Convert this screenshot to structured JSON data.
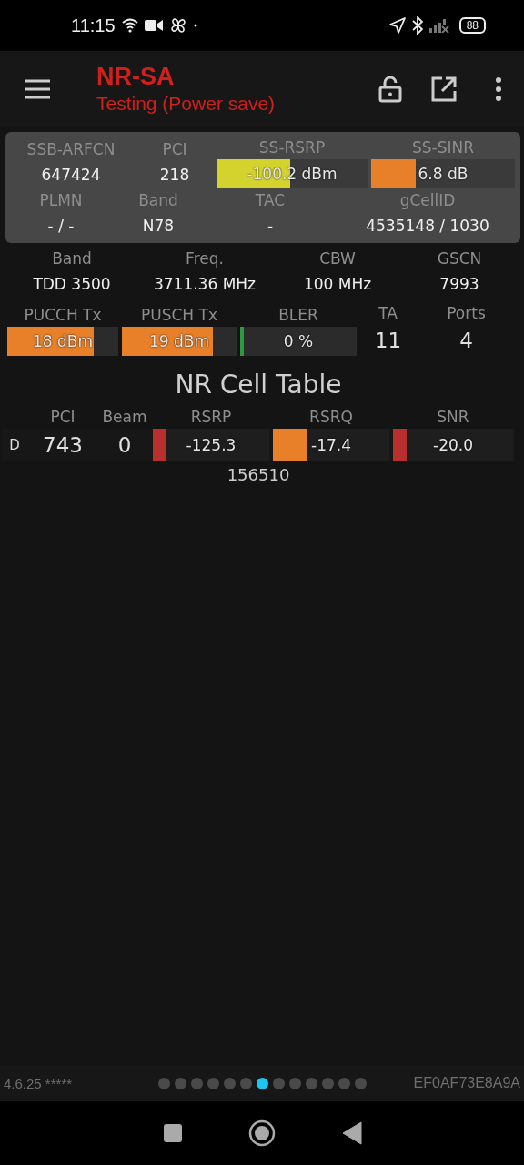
{
  "status_bar": {
    "time": "11:15",
    "battery": "88"
  },
  "app_bar": {
    "title": "NR-SA",
    "subtitle": "Testing (Power save)"
  },
  "serving_panel": {
    "rows": [
      [
        {
          "label": "SSB-ARFCN",
          "kind": "text",
          "value": "647424"
        },
        {
          "label": "PCI",
          "kind": "text",
          "value": "218"
        },
        {
          "label": "SS-RSRP",
          "kind": "meter",
          "value": "-100.2 dBm",
          "level": 0.49,
          "color": "#d4d22c"
        },
        {
          "label": "SS-SINR",
          "kind": "meter",
          "value": "6.8 dB",
          "level": 0.31,
          "color": "#e8802a"
        }
      ],
      [
        {
          "label": "PLMN",
          "kind": "text",
          "value": "- / -"
        },
        {
          "label": "Band",
          "kind": "text",
          "value": "N78"
        },
        {
          "label": "TAC",
          "kind": "text",
          "value": "-"
        },
        {
          "label": "gCellID",
          "kind": "text",
          "value": "4535148 / 1030"
        }
      ]
    ]
  },
  "carrier_info": {
    "rows": [
      [
        {
          "label": "Band",
          "kind": "text",
          "value": "TDD 3500"
        },
        {
          "label": "Freq.",
          "kind": "text",
          "value": "3711.36 MHz"
        },
        {
          "label": "CBW",
          "kind": "text",
          "value": "100 MHz"
        },
        {
          "label": "GSCN",
          "kind": "text",
          "value": "7993"
        }
      ]
    ]
  },
  "uplink_info": {
    "rows": [
      [
        {
          "label": "PUCCH Tx",
          "kind": "meter",
          "value": "18 dBm",
          "level": 0.78,
          "color": "#e8802a"
        },
        {
          "label": "PUSCH Tx",
          "kind": "meter",
          "value": "19 dBm",
          "level": 0.79,
          "color": "#e8802a"
        },
        {
          "label": "BLER",
          "kind": "meter",
          "value": "0 %",
          "level": 0.03,
          "color": "#2e9a3e"
        },
        {
          "label": "TA",
          "kind": "big",
          "value": "11"
        },
        {
          "label": "Ports",
          "kind": "big",
          "value": "4"
        }
      ]
    ]
  },
  "cell_table": {
    "title": "NR Cell Table",
    "columns": [
      "PCI",
      "Beam",
      "RSRP",
      "RSRQ",
      "SNR"
    ],
    "rows": [
      {
        "type": "D",
        "cells": [
          {
            "kind": "big",
            "value": "743"
          },
          {
            "kind": "big",
            "value": "0"
          },
          {
            "kind": "meter",
            "value": "-125.3",
            "level": 0.11,
            "color": "#b8302e"
          },
          {
            "kind": "meter",
            "value": "-17.4",
            "level": 0.3,
            "color": "#e8802a"
          },
          {
            "kind": "meter",
            "value": "-20.0",
            "level": 0.11,
            "color": "#b8302e"
          }
        ],
        "extra_value": "156510"
      }
    ]
  },
  "footer": {
    "version": "4.6.25 *****",
    "pages": [
      {
        "selected": false
      },
      {
        "selected": false
      },
      {
        "selected": false
      },
      {
        "selected": false
      },
      {
        "selected": false
      },
      {
        "selected": false
      },
      {
        "selected": true
      },
      {
        "selected": false
      },
      {
        "selected": false
      },
      {
        "selected": false
      },
      {
        "selected": false
      },
      {
        "selected": false
      },
      {
        "selected": false
      }
    ],
    "device_id": "EF0AF73E8A9A"
  }
}
